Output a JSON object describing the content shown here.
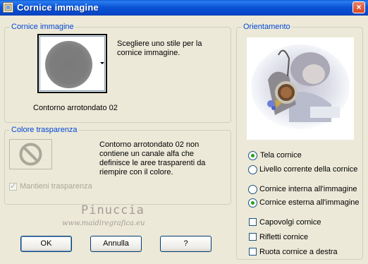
{
  "window": {
    "title": "Cornice immagine",
    "close_label": "×"
  },
  "frame_group": {
    "legend": "Cornice immagine",
    "description": "Scegliere uno stile per la cornice immagine.",
    "selected_frame": "Contorno arrotondato 02"
  },
  "transparency_group": {
    "legend": "Colore trasparenza",
    "message": "Contorno arrotondato 02 non contiene un canale alfa che definisce le aree trasparenti da riempire con il colore.",
    "keep_transparency_label": "Mantieni trasparenza",
    "keep_transparency_checked": true,
    "keep_transparency_enabled": false
  },
  "orientation_group": {
    "legend": "Orientamento",
    "target_options": [
      {
        "label": "Tela cornice",
        "selected": true
      },
      {
        "label": "Livello corrente della cornice",
        "selected": false
      }
    ],
    "placement_options": [
      {
        "label": "Cornice interna all'immagine",
        "selected": false
      },
      {
        "label": "Cornice esterna all'immagine",
        "selected": true
      }
    ],
    "checkboxes": [
      {
        "label": "Capovolgi cornice",
        "checked": false
      },
      {
        "label": "Rifletti cornice",
        "checked": false
      },
      {
        "label": "Ruota cornice a destra",
        "checked": false
      }
    ]
  },
  "buttons": {
    "ok": "OK",
    "cancel": "Annulla",
    "help": "?"
  },
  "watermark": {
    "name": "Pinuccia",
    "site": "www.maidiregrafica.eu"
  },
  "colors": {
    "titlebar": "#0a55d5",
    "legend": "#0046d5",
    "radio_dot": "#21a121"
  },
  "icons": {
    "app": "frame-app-icon",
    "no_preview": "prohibited-icon"
  }
}
